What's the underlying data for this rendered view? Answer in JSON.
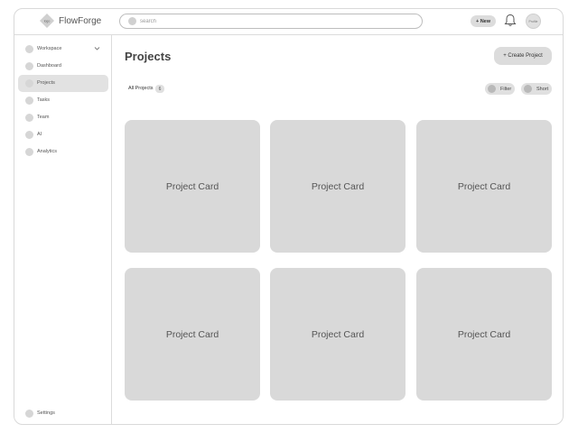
{
  "header": {
    "logo_text": "FlowForge",
    "logo_mark": "logo",
    "search_placeholder": "search",
    "new_label": "+ New",
    "avatar_label": "Profile"
  },
  "sidebar": {
    "items": [
      {
        "label": "Workspace",
        "icon": "dot"
      },
      {
        "label": "Dashboard",
        "icon": "dot"
      },
      {
        "label": "Projects",
        "icon": "dot"
      },
      {
        "label": "Tasks",
        "icon": "dot"
      },
      {
        "label": "Team",
        "icon": "dot"
      },
      {
        "label": "AI",
        "icon": "dot"
      },
      {
        "label": "Analytics",
        "icon": "dot"
      }
    ],
    "active_item": "Projects",
    "settings_label": "Settings"
  },
  "main": {
    "title": "Projects",
    "create_label": "+ Create Project",
    "filter_tab": "All Projects",
    "count": "6",
    "filter_label": "Filter",
    "sort_label": "Short",
    "cards": [
      {
        "label": "Project Card"
      },
      {
        "label": "Project Card"
      },
      {
        "label": "Project Card"
      },
      {
        "label": "Project Card"
      },
      {
        "label": "Project Card"
      },
      {
        "label": "Project Card"
      }
    ]
  },
  "colors": {
    "card": "#d9d9d9",
    "active_nav": "#e2e2e2",
    "button": "#dcdcdc",
    "border": "#dcdcdc"
  }
}
